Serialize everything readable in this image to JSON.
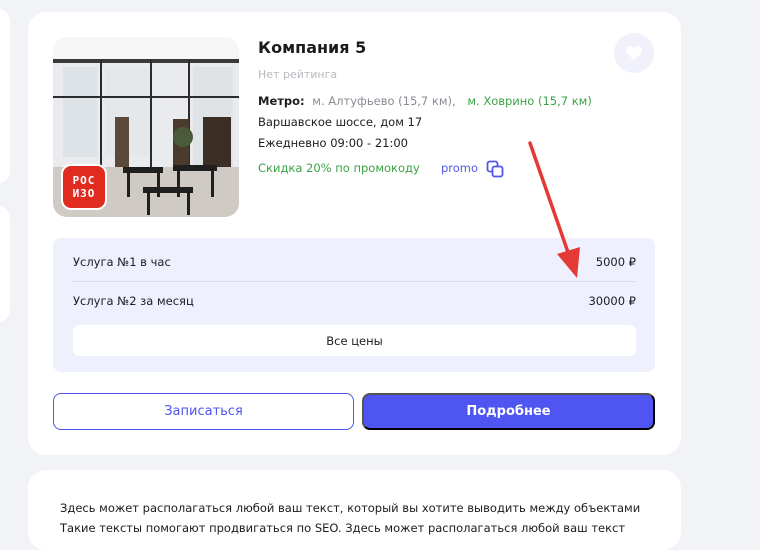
{
  "listing": {
    "title": "Компания 5",
    "rating_text": "Нет рейтинга",
    "logo_text_line1": "РОС",
    "logo_text_line2": "ИЗО",
    "metro_label": "Метро:",
    "metro_station_1": "м. Алтуфьево (15,7 км),",
    "metro_station_2": "м. Ховрино (15,7 км)",
    "address": "Варшавское шоссе, дом 17",
    "hours": "Ежедневно 09:00 - 21:00",
    "discount": "Скидка 20% по промокоду",
    "promo_code": "promo",
    "icons": {
      "favorite": "heart-icon",
      "copy": "copy-icon"
    }
  },
  "prices": {
    "rows": [
      {
        "name": "Услуга №1 в час",
        "price": "5000 ₽"
      },
      {
        "name": "Услуга №2 за месяц",
        "price": "30000 ₽"
      }
    ],
    "all_prices_label": "Все цены"
  },
  "actions": {
    "book_label": "Записаться",
    "details_label": "Подробнее"
  },
  "info_text": "Здесь может располагаться любой ваш текст, который вы хотите выводить между объектами Такие тексты помогают продвигаться по SEO. Здесь может располагаться любой ваш текст",
  "colors": {
    "accent": "#4f55f1",
    "green": "#3aa344",
    "annotation_arrow": "#e53935",
    "prices_bg": "#eff0fd"
  }
}
